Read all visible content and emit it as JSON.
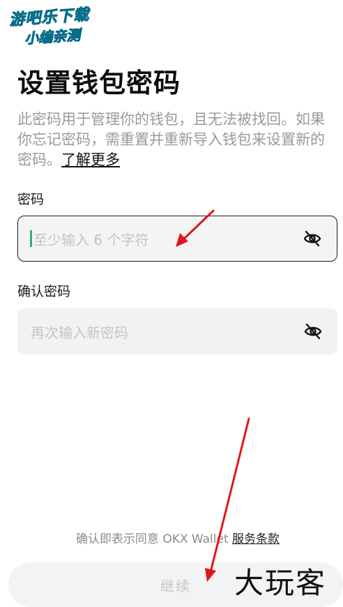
{
  "watermark_top": {
    "line1": "游吧乐下载",
    "line2": "小编亲测"
  },
  "page": {
    "title": "设置钱包密码",
    "description": "此密码用于管理你的钱包，且无法被找回。如果你忘记密码，需重置并重新导入钱包来设置新的密码。",
    "learn_more": "了解更多"
  },
  "password": {
    "label": "密码",
    "placeholder": "至少输入 6 个字符",
    "toggle_icon": "eye-off-icon"
  },
  "confirm_password": {
    "label": "确认密码",
    "placeholder": "再次输入新密码",
    "toggle_icon": "eye-off-icon"
  },
  "terms": {
    "prefix": "确认即表示同意 OKX Wallet ",
    "link": "服务条款"
  },
  "continue_button": {
    "label": "继续"
  },
  "watermark_bottom": {
    "text": "大玩客"
  },
  "colors": {
    "caret": "#2fb36a",
    "annotation_arrow": "#e0161b",
    "field_background": "#f2f2f2"
  }
}
